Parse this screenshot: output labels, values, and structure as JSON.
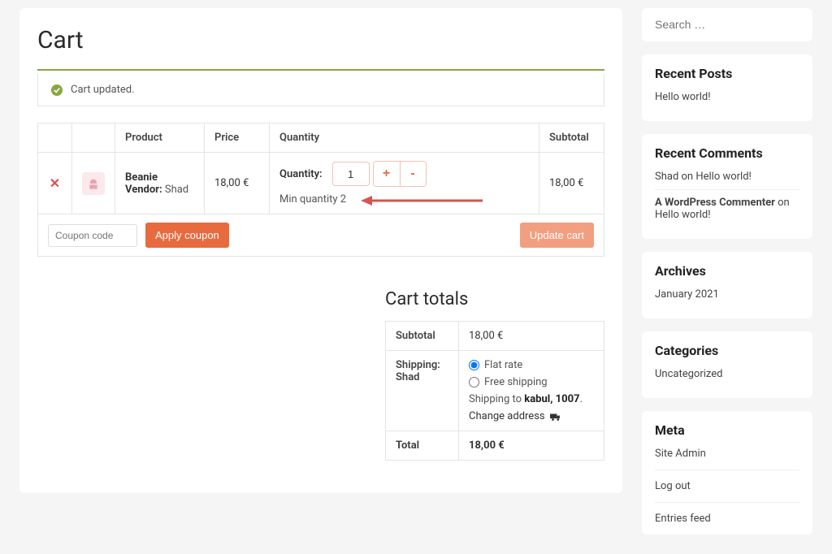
{
  "page": {
    "title": "Cart",
    "notice": "Cart updated."
  },
  "cart": {
    "headers": {
      "product": "Product",
      "price": "Price",
      "quantity": "Quantity",
      "subtotal": "Subtotal"
    },
    "item": {
      "name": "Beanie",
      "vendor_label": "Vendor:",
      "vendor_name": "Shad",
      "price": "18,00 €",
      "qty_label": "Quantity:",
      "qty_value": "1",
      "min_note": "Min quantity 2",
      "subtotal": "18,00 €"
    },
    "coupon_placeholder": "Coupon code",
    "apply_coupon": "Apply coupon",
    "update_cart": "Update cart"
  },
  "totals": {
    "title": "Cart totals",
    "subtotal_label": "Subtotal",
    "subtotal_value": "18,00 €",
    "shipping_label": "Shipping: Shad",
    "flat_rate": "Flat rate",
    "free_shipping": "Free shipping",
    "shipping_to_prefix": "Shipping to ",
    "shipping_to_dest": "kabul, 1007",
    "change_address": "Change address",
    "total_label": "Total",
    "total_value": "18,00 €"
  },
  "sidebar": {
    "search_placeholder": "Search …",
    "recent_posts": {
      "title": "Recent Posts",
      "items": [
        "Hello world!"
      ]
    },
    "recent_comments": {
      "title": "Recent Comments",
      "items": [
        {
          "author": "Shad",
          "on": " on ",
          "post": "Hello world!"
        },
        {
          "author": "A WordPress Commenter",
          "on": " on ",
          "post": "Hello world!"
        }
      ]
    },
    "archives": {
      "title": "Archives",
      "items": [
        "January 2021"
      ]
    },
    "categories": {
      "title": "Categories",
      "items": [
        "Uncategorized"
      ]
    },
    "meta": {
      "title": "Meta",
      "items": [
        "Site Admin",
        "Log out",
        "Entries feed"
      ]
    }
  }
}
